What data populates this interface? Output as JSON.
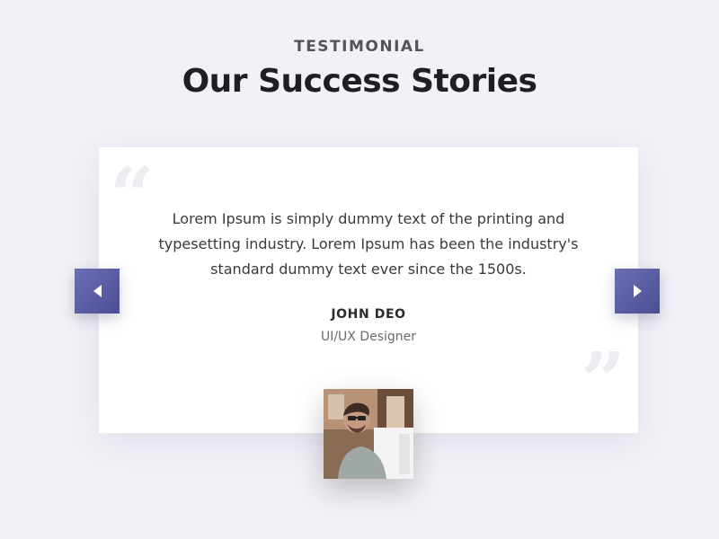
{
  "header": {
    "eyebrow": "TESTIMONIAL",
    "title": "Our Success Stories"
  },
  "testimonial": {
    "quote": "Lorem Ipsum is simply dummy text of the printing and typesetting industry. Lorem Ipsum has been the industry's standard dummy text ever since the 1500s.",
    "author": "JOHN DEO",
    "role": "UI/UX Designer"
  },
  "icons": {
    "quote_open": "left-quote-icon",
    "quote_close": "right-quote-icon",
    "prev": "caret-left-icon",
    "next": "caret-right-icon"
  },
  "colors": {
    "background": "#f2f1f7",
    "nav_button": "#5a5ea2",
    "card": "#ffffff",
    "quote_mark": "#ececf1"
  }
}
